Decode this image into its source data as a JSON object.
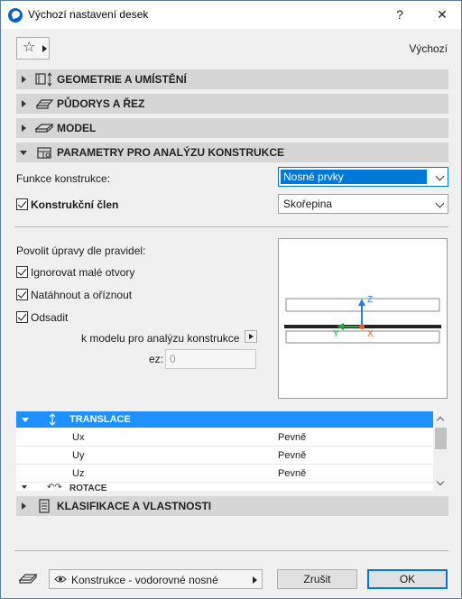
{
  "window": {
    "title": "Výchozí nastavení desek",
    "help_label": "?",
    "close_label": "✕"
  },
  "toolbar": {
    "default_label": "Výchozí"
  },
  "sections": {
    "geometry": "GEOMETRIE A UMÍSTĚNÍ",
    "plans": "PŮDORYS A ŘEZ",
    "model": "MODEL",
    "structural": "PARAMETRY PRO ANALÝZU KONSTRUKCE",
    "classification": "KLASIFIKACE A VLASTNOSTI"
  },
  "structural": {
    "function_label": "Funkce konstrukce:",
    "function_value": "Nosné prvky",
    "member_label": "Konstrukční člen",
    "member_checked": true,
    "member_value": "Skořepina",
    "rules_label": "Povolit úpravy dle pravidel:",
    "ignore_openings_label": "Ignorovat malé otvory",
    "ignore_openings_checked": true,
    "extend_trim_label": "Natáhnout a oříznout",
    "extend_trim_checked": true,
    "offset_label": "Odsadit",
    "offset_checked": true,
    "to_model_label": "k modelu pro analýzu konstrukce",
    "offset_value_label": "ez:",
    "offset_value": "0"
  },
  "preview": {
    "axis_z": "Z",
    "axis_y": "Y",
    "axis_x": "X"
  },
  "tree": {
    "translation_label": "TRANSLACE",
    "rows": [
      {
        "key": "Ux",
        "value": "Pevně"
      },
      {
        "key": "Uy",
        "value": "Pevně"
      },
      {
        "key": "Uz",
        "value": "Pevně"
      }
    ],
    "rotation_label": "ROTACE"
  },
  "footer": {
    "layer_value": "Konstrukce - vodorovné nosné",
    "cancel_label": "Zrušit",
    "ok_label": "OK"
  },
  "colors": {
    "accent": "#0078d7",
    "tree_header": "#1e90ff",
    "section_bg": "#d6d6d6"
  }
}
